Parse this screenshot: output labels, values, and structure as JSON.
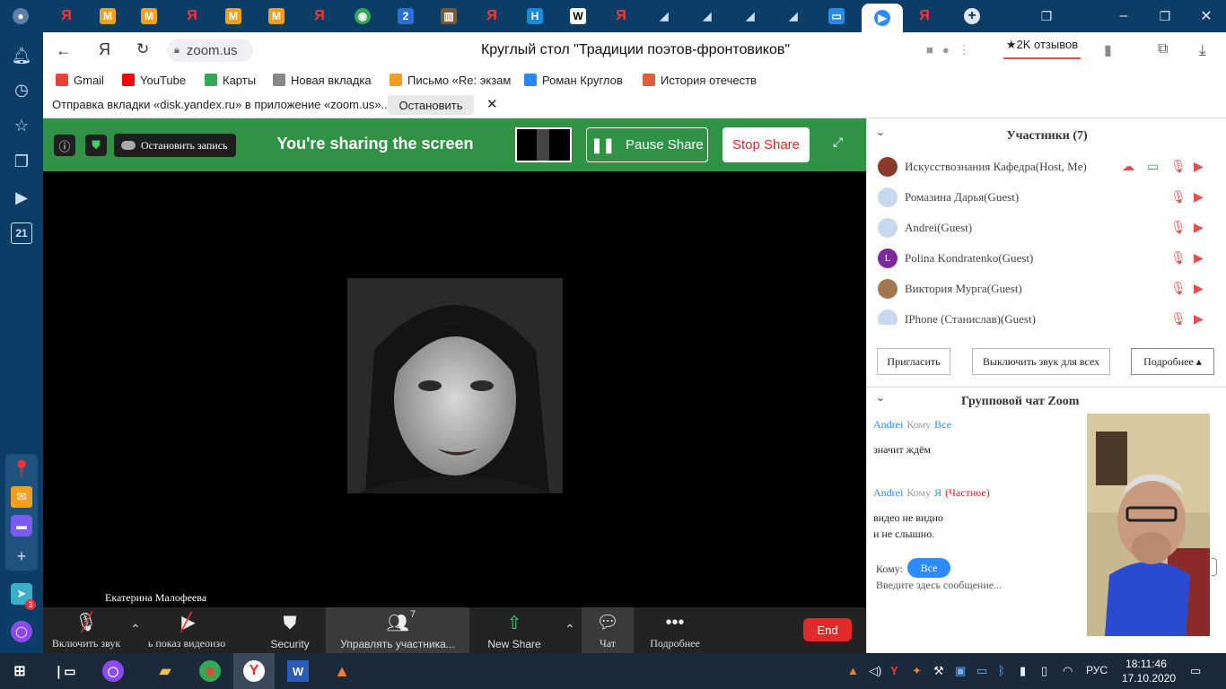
{
  "browser": {
    "url": "zoom.us",
    "page_title": "Круглый стол \"Традиции поэтов-фронтовиков\"",
    "reviews_label": "★2K отзывов",
    "bookmarks": [
      {
        "label": "Gmail",
        "color": "#ea4335"
      },
      {
        "label": "YouTube",
        "color": "#ff0000"
      },
      {
        "label": "Карты",
        "color": "#34a853"
      },
      {
        "label": "Новая вкладка",
        "color": "#888888"
      },
      {
        "label": "Письмо «Re: экзам",
        "color": "#f0a020"
      },
      {
        "label": "Роман Круглов",
        "color": "#2787f5"
      },
      {
        "label": "История отечеств",
        "color": "#e0603a"
      }
    ],
    "notification": {
      "text": "Отправка вкладки «disk.yandex.ru» в приложение «zoom.us»...",
      "button": "Остановить"
    },
    "sidebar_calendar": "21",
    "sidebar_badge": "3"
  },
  "sharebar": {
    "record_label": "Остановить запись",
    "title": "You're sharing the screen",
    "pause_label": "Pause Share",
    "stop_label": "Stop Share"
  },
  "video": {
    "speaker_name": "Екатерина Малофеева"
  },
  "bottombar": {
    "unmute": "Включить звук",
    "start_video": "ь показ видеоизо",
    "security": "Security",
    "participants": "Управлять участника...",
    "participants_count": "7",
    "new_share": "New Share",
    "chat": "Чат",
    "more": "Подробнее",
    "end": "End"
  },
  "participants": {
    "header": "Участники (7)",
    "list": [
      {
        "name": "Искусствознания Кафедра(Host, Me)",
        "avatar": "#8a3a2a"
      },
      {
        "name": "Ромазина Дарья(Guest)",
        "avatar": "#c8d8ee"
      },
      {
        "name": "Andrei(Guest)",
        "avatar": "#c8d8ee"
      },
      {
        "name": "Polina Kondratenko(Guest)",
        "avatar": "#7a2a9a",
        "initial": "L"
      },
      {
        "name": "Виктория Мурга(Guest)",
        "avatar": "#a07850"
      },
      {
        "name": "IPhone (Станислав)(Guest)",
        "avatar": "#c8d8ee"
      }
    ],
    "invite": "Пригласить",
    "mute_all": "Выключить звук для всех",
    "more": "Подробнее ▴"
  },
  "chat": {
    "header": "Групповой чат Zoom",
    "messages": [
      {
        "from": "Andrei",
        "to_word": "Кому",
        "to": "Все",
        "private": "",
        "lines": [
          "значит ждём"
        ]
      },
      {
        "from": "Andrei",
        "to_word": "Кому",
        "to": "Я",
        "private": "(Частное)",
        "lines": [
          "видео не видно",
          "и не слышно."
        ]
      }
    ],
    "to_label": "Кому:",
    "to_value": "Все",
    "input_placeholder": "Введите здесь сообщение..."
  },
  "taskbar": {
    "language": "РУС",
    "time": "18:11:46",
    "date": "17.10.2020"
  }
}
